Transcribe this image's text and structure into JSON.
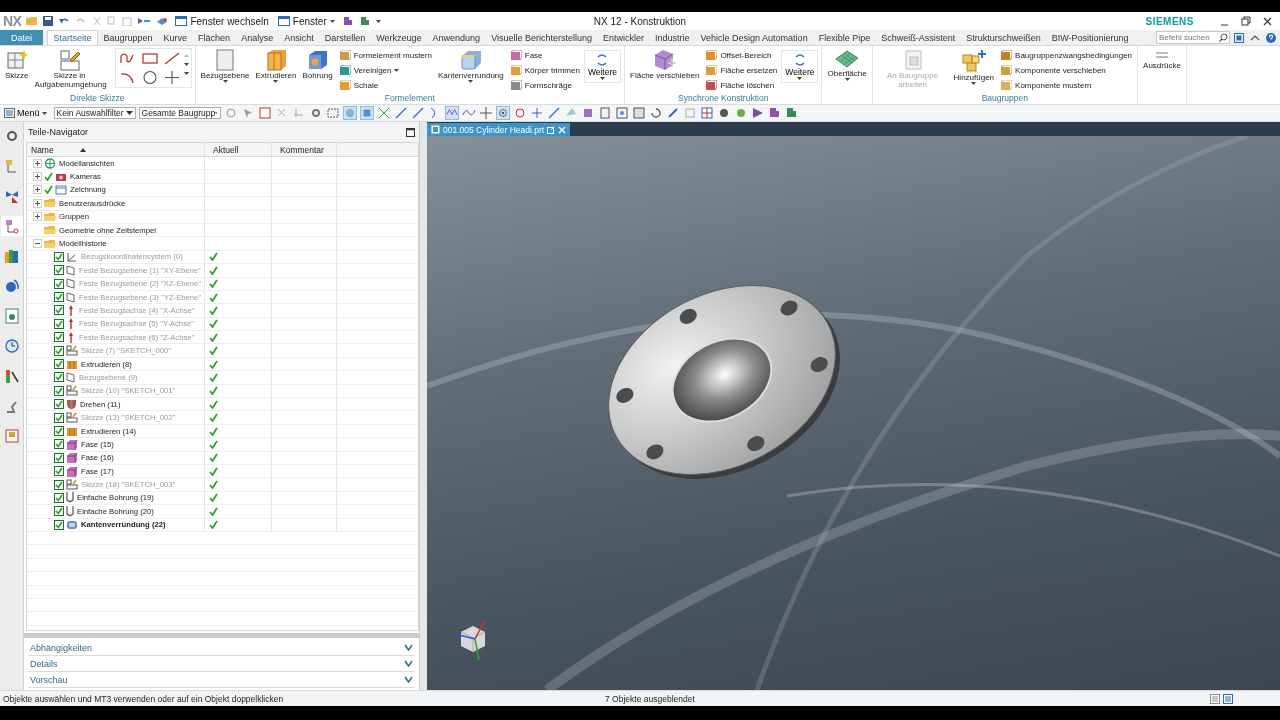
{
  "window": {
    "logo": "NX",
    "title": "NX 12 - Konstruktion",
    "brand": "SIEMENS"
  },
  "quick_access": [
    {
      "label": "Fenster wechseln",
      "dropdown": false
    },
    {
      "label": "Fenster",
      "dropdown": true
    }
  ],
  "menu_tabs": [
    {
      "label": "Datei",
      "kind": "file",
      "selected": false
    },
    {
      "label": "Startseite",
      "kind": "tab",
      "selected": true
    },
    {
      "label": "Baugruppen",
      "kind": "tab",
      "selected": false
    },
    {
      "label": "Kurve",
      "kind": "tab",
      "selected": false
    },
    {
      "label": "Flächen",
      "kind": "tab",
      "selected": false
    },
    {
      "label": "Analyse",
      "kind": "tab",
      "selected": false
    },
    {
      "label": "Ansicht",
      "kind": "tab",
      "selected": false
    },
    {
      "label": "Darstellen",
      "kind": "tab",
      "selected": false
    },
    {
      "label": "Werkzeuge",
      "kind": "tab",
      "selected": false
    },
    {
      "label": "Anwendung",
      "kind": "tab",
      "selected": false
    },
    {
      "label": "Visuelle Berichterstellung",
      "kind": "tab",
      "selected": false
    },
    {
      "label": "Entwickler",
      "kind": "tab",
      "selected": false
    },
    {
      "label": "Industrie",
      "kind": "tab",
      "selected": false
    },
    {
      "label": "Vehicle Design Automation",
      "kind": "tab",
      "selected": false
    },
    {
      "label": "Flexible Pipe",
      "kind": "tab",
      "selected": false
    },
    {
      "label": "Schweiß-Assistent",
      "kind": "tab",
      "selected": false
    },
    {
      "label": "Strukturschweißen",
      "kind": "tab",
      "selected": false
    },
    {
      "label": "BIW-Positionierung",
      "kind": "tab",
      "selected": false
    }
  ],
  "command_search": {
    "placeholder": "Befehl suchen"
  },
  "ribbon": [
    {
      "label": "Direkte Skizze",
      "items": [
        {
          "kind": "large",
          "label": "Skizze",
          "dropdown": false,
          "disabled": false
        },
        {
          "kind": "large",
          "label": "Skizze in Aufgabenumgebung",
          "dropdown": false,
          "disabled": false
        },
        {
          "kind": "gallery"
        }
      ]
    },
    {
      "label": "Formelement",
      "items": [
        {
          "kind": "large",
          "label": "Bezugsebene",
          "dropdown": true,
          "disabled": false
        },
        {
          "kind": "large",
          "label": "Extrudieren",
          "dropdown": true,
          "disabled": false
        },
        {
          "kind": "large",
          "label": "Bohrung",
          "dropdown": false,
          "disabled": false
        },
        {
          "kind": "stack",
          "entries": [
            {
              "label": "Formelement mustern",
              "dropdown": false
            },
            {
              "label": "Vereinigen",
              "dropdown": true
            },
            {
              "label": "Schale",
              "dropdown": false
            }
          ]
        },
        {
          "kind": "large",
          "label": "Kantenverrundung",
          "dropdown": true,
          "disabled": false
        },
        {
          "kind": "stack",
          "entries": [
            {
              "label": "Fase",
              "dropdown": false
            },
            {
              "label": "Körper trimmen",
              "dropdown": false
            },
            {
              "label": "Formschräge",
              "dropdown": false
            }
          ]
        },
        {
          "kind": "more",
          "label": "Weitere"
        }
      ]
    },
    {
      "label": "Synchrone Konstruktion",
      "items": [
        {
          "kind": "large",
          "label": "Fläche verschieben",
          "dropdown": false,
          "disabled": false
        },
        {
          "kind": "stack",
          "entries": [
            {
              "label": "Offset-Bereich",
              "dropdown": false
            },
            {
              "label": "Fläche ersetzen",
              "dropdown": false
            },
            {
              "label": "Fläche löschen",
              "dropdown": false
            }
          ]
        },
        {
          "kind": "more",
          "label": "Weitere"
        }
      ]
    },
    {
      "items": [
        {
          "kind": "large",
          "label": "Oberfläche",
          "dropdown": true,
          "disabled": false
        }
      ]
    },
    {
      "label": "Baugruppen",
      "items": [
        {
          "kind": "large",
          "label": "An Baugruppe arbeiten",
          "dropdown": false,
          "disabled": true
        },
        {
          "kind": "large",
          "label": "Hinzufügen",
          "dropdown": true,
          "disabled": false
        },
        {
          "kind": "stack",
          "entries": [
            {
              "label": "Baugruppenzwangsbedingungen",
              "dropdown": false
            },
            {
              "label": "Komponente verschieben",
              "dropdown": false
            },
            {
              "label": "Komponente mustern",
              "dropdown": false
            }
          ]
        }
      ]
    },
    {
      "items": [
        {
          "kind": "large",
          "label": "Ausdrücke",
          "dropdown": false,
          "disabled": false
        }
      ]
    }
  ],
  "toolbar": {
    "menu": "Menü",
    "filters": [
      "Kein Auswahlfilter",
      "Gesamte Baugrupp"
    ]
  },
  "navigator": {
    "title": "Teile-Navigator",
    "columns": [
      "Name",
      "Aktuell",
      "Kommentar"
    ],
    "tree": [
      {
        "label": "Modellansichten",
        "kind": "views",
        "toggle": true,
        "expanded": false,
        "shown": false
      },
      {
        "label": "Kameras",
        "kind": "cameras",
        "toggle": true,
        "expanded": false,
        "shown": true
      },
      {
        "label": "Zeichnung",
        "kind": "drawing",
        "toggle": true,
        "expanded": false,
        "shown": true
      },
      {
        "label": "Benutzerausdrücke",
        "kind": "folder",
        "toggle": true,
        "expanded": false,
        "shown": false
      },
      {
        "label": "Gruppen",
        "kind": "folder",
        "toggle": true,
        "expanded": false,
        "shown": false
      },
      {
        "label": "Geometrie ohne Zeitstempel",
        "kind": "folder",
        "toggle": false,
        "shown": false
      },
      {
        "label": "Modellhistorie",
        "kind": "folder",
        "toggle": true,
        "expanded": true,
        "shown": false,
        "children": [
          {
            "label": "Bezugskoordinatensystem (0)",
            "kind": "csys",
            "checked": true,
            "current": true,
            "dimmed": true,
            "bold": false
          },
          {
            "label": "Feste Bezugsebene (1) \"XY-Ebene\"",
            "kind": "plane",
            "checked": true,
            "current": true,
            "dimmed": true,
            "bold": false
          },
          {
            "label": "Feste Bezugsebene (2) \"XZ-Ebene\"",
            "kind": "plane",
            "checked": true,
            "current": true,
            "dimmed": true,
            "bold": false
          },
          {
            "label": "Feste Bezugsebene (3) \"YZ-Ebene\"",
            "kind": "plane",
            "checked": true,
            "current": true,
            "dimmed": true,
            "bold": false
          },
          {
            "label": "Feste Bezugsachse (4) \"X-Achse\"",
            "kind": "axis",
            "checked": true,
            "current": true,
            "dimmed": true,
            "bold": false
          },
          {
            "label": "Feste Bezugsachse (5) \"Y-Achse\"",
            "kind": "axis",
            "checked": true,
            "current": true,
            "dimmed": true,
            "bold": false
          },
          {
            "label": "Feste Bezugsachse (6) \"Z-Achse\"",
            "kind": "axis",
            "checked": true,
            "current": true,
            "dimmed": true,
            "bold": false
          },
          {
            "label": "Skizze (7) \"SKETCH_000\"",
            "kind": "sketch",
            "checked": true,
            "current": true,
            "dimmed": true,
            "bold": false
          },
          {
            "label": "Extrudieren (8)",
            "kind": "extrude",
            "checked": true,
            "current": true,
            "dimmed": false,
            "bold": false
          },
          {
            "label": "Bezugsebene (9)",
            "kind": "plane",
            "checked": true,
            "current": true,
            "dimmed": true,
            "bold": false
          },
          {
            "label": "Skizze (10) \"SKETCH_001\"",
            "kind": "sketch",
            "checked": true,
            "current": true,
            "dimmed": true,
            "bold": false
          },
          {
            "label": "Drehen (11)",
            "kind": "revolve",
            "checked": true,
            "current": true,
            "dimmed": false,
            "bold": false
          },
          {
            "label": "Skizze (13) \"SKETCH_002\"",
            "kind": "sketch",
            "checked": true,
            "current": true,
            "dimmed": true,
            "bold": false
          },
          {
            "label": "Extrudieren (14)",
            "kind": "extrude",
            "checked": true,
            "current": true,
            "dimmed": false,
            "bold": false
          },
          {
            "label": "Fase (15)",
            "kind": "chamfer",
            "checked": true,
            "current": true,
            "dimmed": false,
            "bold": false
          },
          {
            "label": "Fase (16)",
            "kind": "chamfer",
            "checked": true,
            "current": true,
            "dimmed": false,
            "bold": false
          },
          {
            "label": "Fase (17)",
            "kind": "chamfer",
            "checked": true,
            "current": true,
            "dimmed": false,
            "bold": false
          },
          {
            "label": "Skizze (18) \"SKETCH_003\"",
            "kind": "sketch",
            "checked": true,
            "current": true,
            "dimmed": true,
            "bold": false
          },
          {
            "label": "Einfache Bohrung (19)",
            "kind": "hole",
            "checked": true,
            "current": true,
            "dimmed": false,
            "bold": false
          },
          {
            "label": "Einfache Bohrung (20)",
            "kind": "hole",
            "checked": true,
            "current": true,
            "dimmed": false,
            "bold": false
          },
          {
            "label": "Kantenverrundung (22)",
            "kind": "blend",
            "checked": true,
            "current": true,
            "dimmed": false,
            "bold": true
          }
        ]
      }
    ],
    "panels": [
      {
        "label": "Abhängigkeiten",
        "expanded": false
      },
      {
        "label": "Details",
        "expanded": false
      },
      {
        "label": "Vorschau",
        "expanded": false
      }
    ]
  },
  "document_tab": {
    "label": "001.005 Cylinder Headi.prt",
    "selected": true
  },
  "status_bar": {
    "message": "Objekte auswählen und MT3 verwenden oder auf ein Objekt doppelklicken",
    "info": "7 Objekte ausgeblendet"
  }
}
